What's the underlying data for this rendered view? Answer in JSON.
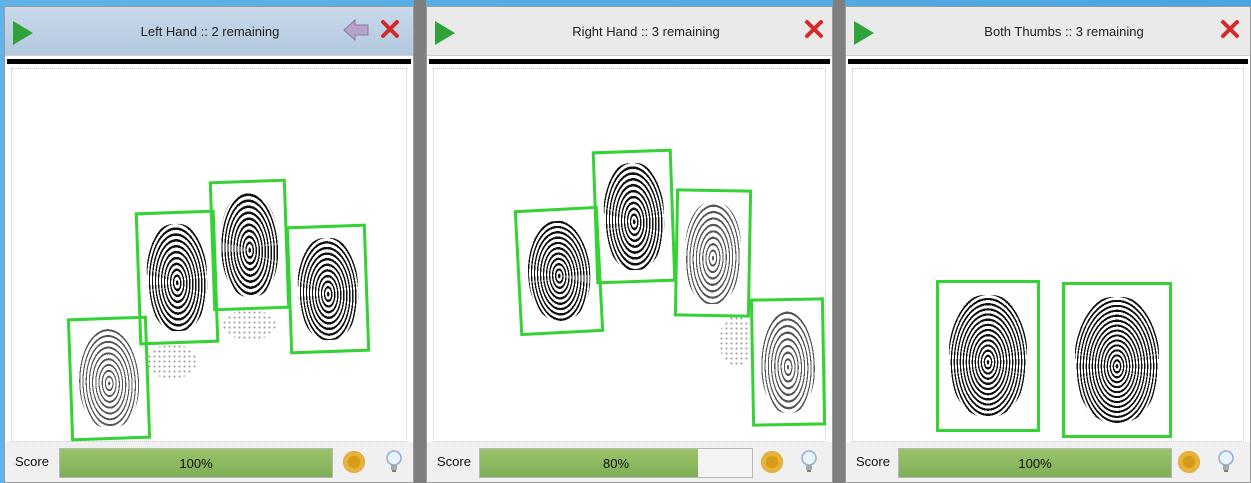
{
  "panels": [
    {
      "id": "left-hand",
      "title": "Left Hand :: 2 remaining",
      "score_label": "Score",
      "score_text": "100%",
      "score_value": 1.0,
      "has_back": true
    },
    {
      "id": "right-hand",
      "title": "Right Hand :: 3 remaining",
      "score_label": "Score",
      "score_text": "80%",
      "score_value": 0.8,
      "has_back": false
    },
    {
      "id": "both-thumbs",
      "title": "Both Thumbs :: 3 remaining",
      "score_label": "Score",
      "score_text": "100%",
      "score_value": 1.0,
      "has_back": false
    }
  ],
  "icons": {
    "play": "play-icon",
    "close": "close-icon",
    "back": "back-arrow-icon",
    "settings": "gear-icon",
    "hint": "lightbulb-icon"
  },
  "colors": {
    "accent_green": "#35d235",
    "play_green": "#2fa33a",
    "score_fill": "#8cb85d",
    "close_red": "#d02b2b",
    "desktop_blue": "#4aa5df"
  }
}
